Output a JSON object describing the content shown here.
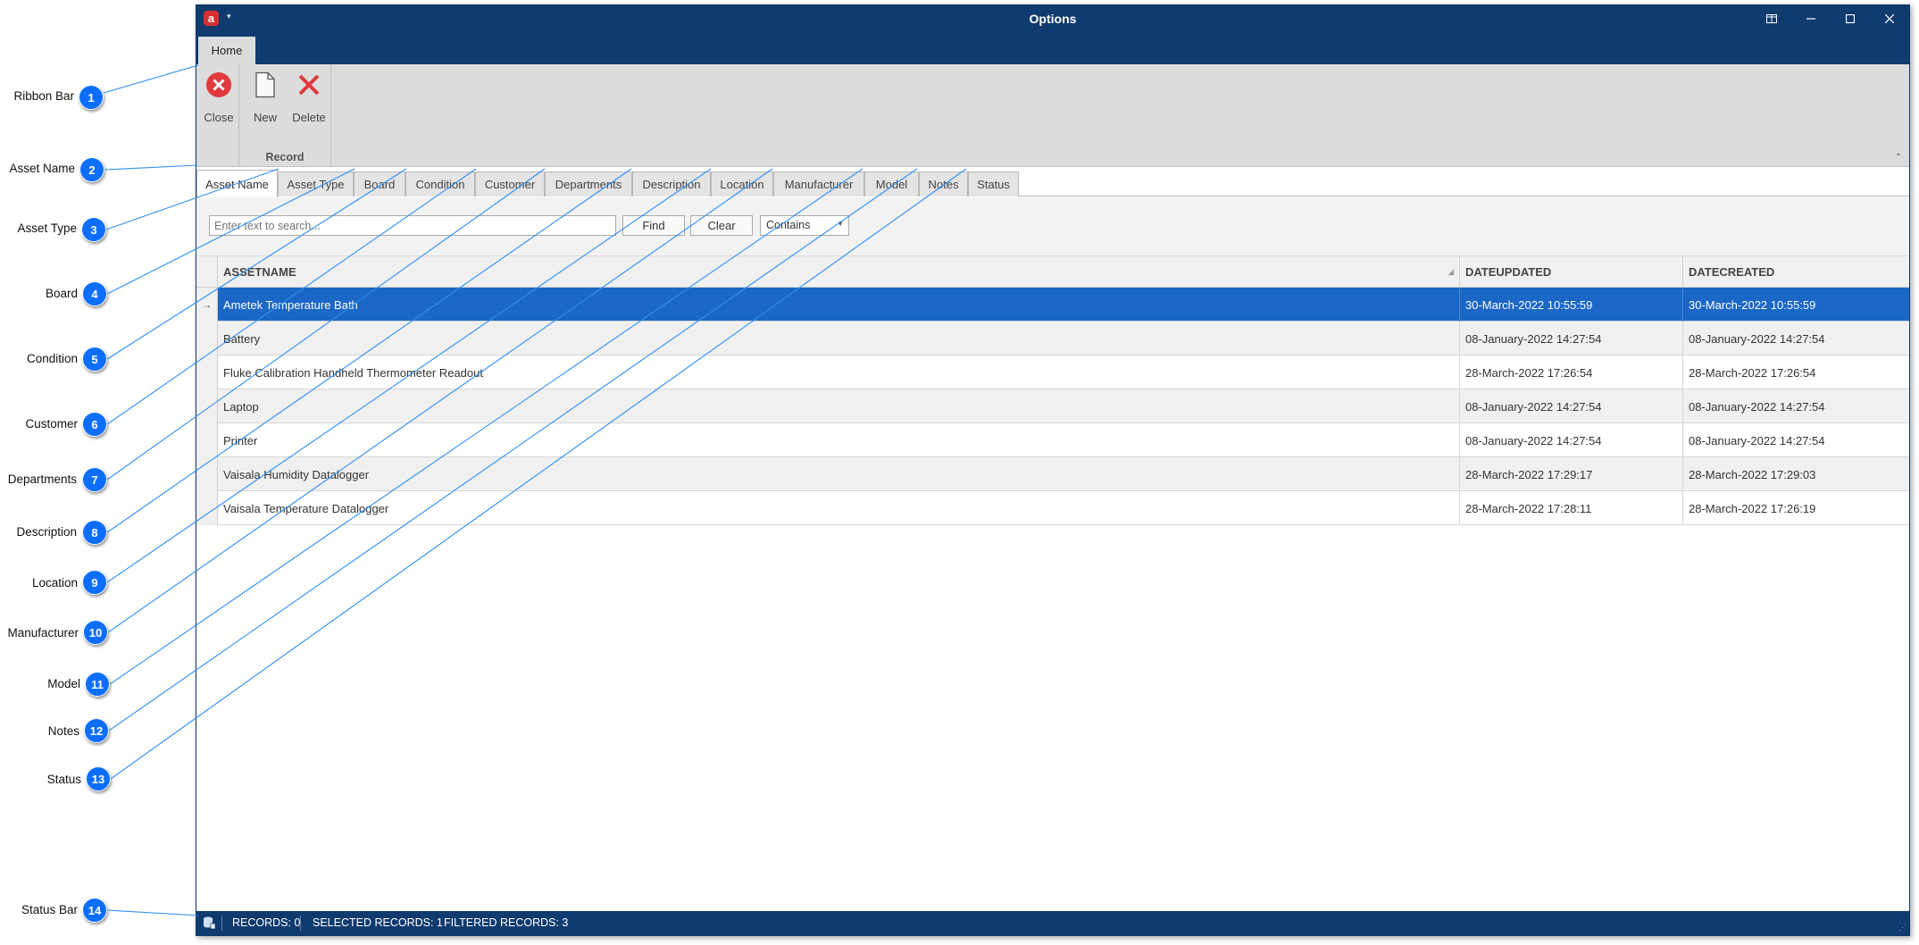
{
  "window": {
    "title": "Options",
    "logo_letter": "a"
  },
  "ribbon": {
    "tabs": [
      {
        "label": "Home"
      }
    ],
    "buttons": {
      "close": "Close",
      "new": "New",
      "delete": "Delete"
    },
    "group_caption": "Record"
  },
  "doc_tabs": [
    "Asset Name",
    "Asset Type",
    "Board",
    "Condition",
    "Customer",
    "Departments",
    "Description",
    "Location",
    "Manufacturer",
    "Model",
    "Notes",
    "Status"
  ],
  "search": {
    "placeholder": "Enter text to search...",
    "find": "Find",
    "clear": "Clear",
    "match_mode": "Contains"
  },
  "grid": {
    "columns": [
      "ASSETNAME",
      "DATEUPDATED",
      "DATECREATED"
    ],
    "row_indicator": "→",
    "rows": [
      {
        "name": "Ametek Temperature Bath",
        "updated": "30-March-2022 10:55:59",
        "created": "30-March-2022 10:55:59"
      },
      {
        "name": "Battery",
        "updated": "08-January-2022 14:27:54",
        "created": "08-January-2022 14:27:54"
      },
      {
        "name": "Fluke Calibration Handheld Thermometer Readout",
        "updated": "28-March-2022 17:26:54",
        "created": "28-March-2022 17:26:54"
      },
      {
        "name": "Laptop",
        "updated": "08-January-2022 14:27:54",
        "created": "08-January-2022 14:27:54"
      },
      {
        "name": "Printer",
        "updated": "08-January-2022 14:27:54",
        "created": "08-January-2022 14:27:54"
      },
      {
        "name": "Vaisala Humidity Datalogger",
        "updated": "28-March-2022 17:29:17",
        "created": "28-March-2022 17:29:03"
      },
      {
        "name": "Vaisala Temperature Datalogger",
        "updated": "28-March-2022 17:28:11",
        "created": "28-March-2022 17:26:19"
      }
    ]
  },
  "status_bar": {
    "records": "RECORDS: 0",
    "selected": "SELECTED RECORDS: 1",
    "filtered": "FILTERED RECORDS: 3"
  },
  "callouts": [
    {
      "n": "1",
      "label": "Ribbon Bar"
    },
    {
      "n": "2",
      "label": "Asset Name"
    },
    {
      "n": "3",
      "label": "Asset Type"
    },
    {
      "n": "4",
      "label": "Board"
    },
    {
      "n": "5",
      "label": "Condition"
    },
    {
      "n": "6",
      "label": "Customer"
    },
    {
      "n": "7",
      "label": "Departments"
    },
    {
      "n": "8",
      "label": "Description"
    },
    {
      "n": "9",
      "label": "Location"
    },
    {
      "n": "10",
      "label": "Manufacturer"
    },
    {
      "n": "11",
      "label": "Model"
    },
    {
      "n": "12",
      "label": "Notes"
    },
    {
      "n": "13",
      "label": "Status"
    },
    {
      "n": "14",
      "label": "Status Bar"
    }
  ],
  "colors": {
    "title_bar": "#103b6e",
    "selection": "#1b67c6",
    "callout_badge": "#0d6efd",
    "close_red": "#e03a3e"
  }
}
